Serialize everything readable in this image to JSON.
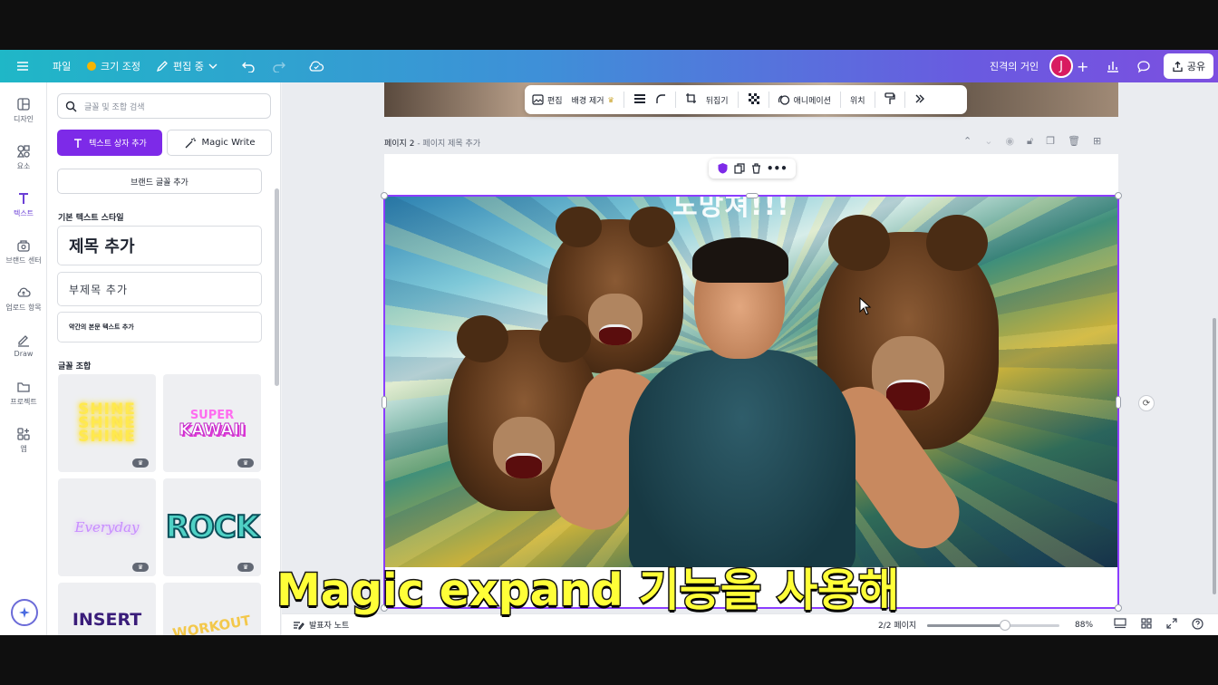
{
  "topbar": {
    "file": "파일",
    "resize": "크기 조정",
    "editing": "편집 중",
    "user_name": "진격의 거인",
    "avatar_initial": "J",
    "share": "공유"
  },
  "rail": [
    {
      "label": "디자인",
      "icon": "layout-icon"
    },
    {
      "label": "요소",
      "icon": "elements-icon"
    },
    {
      "label": "텍스트",
      "icon": "text-icon"
    },
    {
      "label": "브랜드 센터",
      "icon": "brand-icon"
    },
    {
      "label": "업로드 항목",
      "icon": "upload-cloud-icon"
    },
    {
      "label": "Draw",
      "icon": "draw-pen-icon"
    },
    {
      "label": "프로젝트",
      "icon": "folder-icon"
    },
    {
      "label": "앱",
      "icon": "apps-icon"
    }
  ],
  "panel": {
    "search_placeholder": "글꼴 및 조합 검색",
    "add_text_box": "텍스트 상자 추가",
    "magic_write": "Magic Write",
    "brand_fonts": "브랜드 글꼴 추가",
    "basic_styles_label": "기본 텍스트 스타일",
    "heading": "제목 추가",
    "subheading": "부제목 추가",
    "body": "약간의 본문 텍스트 추가",
    "combos_label": "글꼴 조합",
    "combos": {
      "shine": "SHINE",
      "super": "SUPER",
      "kawaii": "KAWAII",
      "everyday": "Everyday",
      "rock": "ROCK",
      "insert": "INSERT",
      "workout": "WORKOUT"
    }
  },
  "context_toolbar": {
    "edit": "편집",
    "remove_bg": "배경 제거",
    "flip": "뒤집기",
    "animate": "애니메이션",
    "position": "위치"
  },
  "page": {
    "label": "페이지 2",
    "title_placeholder": "페이지 제목 추가",
    "image_title": "도망쳐!!!"
  },
  "bottombar": {
    "notes": "발표자 노트",
    "pages": "2/2 페이지",
    "zoom": "88%",
    "zoom_value": 0.88
  },
  "subtitle": "Magic expand 기능을 사용해",
  "colors": {
    "accent": "#7d2ae8",
    "selection": "#8b3dff",
    "subtitle": "#ffff38"
  }
}
